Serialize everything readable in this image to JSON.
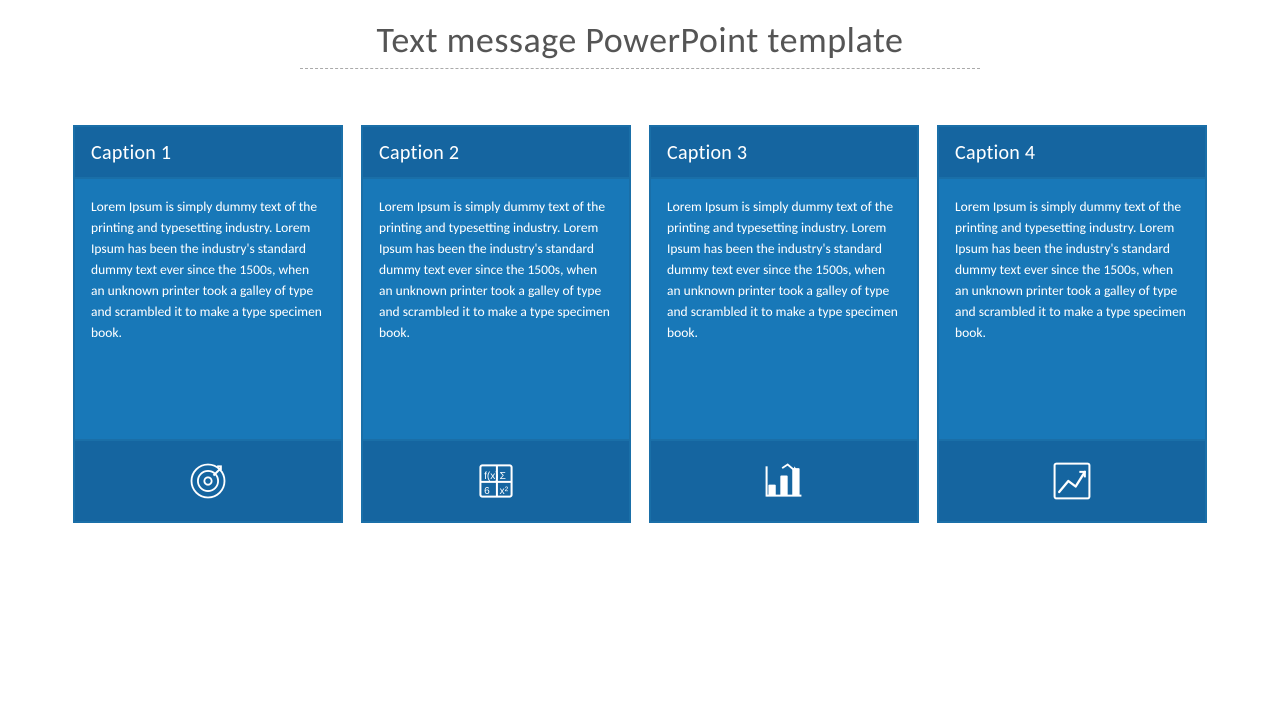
{
  "page": {
    "title": "Text message PowerPoint template"
  },
  "cards": [
    {
      "id": "card-1",
      "caption": "Caption 1",
      "body": "Lorem Ipsum is simply dummy text of the printing and typesetting industry. Lorem Ipsum has been the industry's standard dummy text ever since the 1500s, when an unknown printer took a galley of type and scrambled it to make a type specimen book.",
      "icon": "target"
    },
    {
      "id": "card-2",
      "caption": "Caption 2",
      "body": "Lorem Ipsum is simply dummy text of the printing and typesetting industry. Lorem Ipsum has been the industry's standard dummy text ever since the 1500s, when an unknown printer took a galley of type and scrambled it to make a type specimen book.",
      "icon": "formula"
    },
    {
      "id": "card-3",
      "caption": "Caption 3",
      "body": "Lorem Ipsum is simply dummy text of the printing and typesetting industry. Lorem Ipsum has been the industry's standard dummy text ever since the 1500s, when an unknown printer took a galley of type and scrambled it to make a type specimen book.",
      "icon": "barchart"
    },
    {
      "id": "card-4",
      "caption": "Caption 4",
      "body": "Lorem Ipsum is simply dummy text of the printing and typesetting industry. Lorem Ipsum has been the industry's standard dummy text ever since the 1500s, when an unknown printer took a galley of type and scrambled it to make a type specimen book.",
      "icon": "trendchart"
    }
  ]
}
